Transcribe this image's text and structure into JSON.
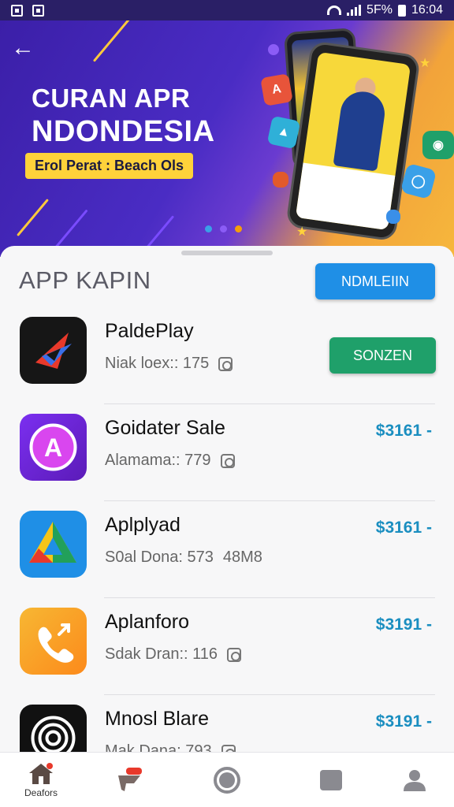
{
  "status_bar": {
    "network": "5F%",
    "time": "16:04"
  },
  "banner": {
    "title_line1": "CURAN APR",
    "title_line2": "NDONDESIA",
    "pill_text": "Erol Perat : Beach Ols"
  },
  "section": {
    "title": "APP KAPIN",
    "header_button": "NDMLEIIN"
  },
  "apps": [
    {
      "name": "PaldePlay",
      "meta": "Niak loex:: 175",
      "size": "",
      "action": "SONZEN",
      "price": ""
    },
    {
      "name": "Goidater Sale",
      "meta": "Alamama:: 779",
      "size": "",
      "action": "",
      "price": "$3161 -"
    },
    {
      "name": "Aplplyad",
      "meta": "S0al Dona: 573",
      "size": "48M8",
      "action": "",
      "price": "$3161 -"
    },
    {
      "name": "Aplanforo",
      "meta": "Sdak Dran:: 116",
      "size": "",
      "action": "",
      "price": "$3191 -"
    },
    {
      "name": "Mnosl Blare",
      "meta": "Mak Dana: 793",
      "size": "",
      "action": "",
      "price": "$3191 -"
    }
  ],
  "bottom_nav": {
    "home_label": "Deafors"
  },
  "colors": {
    "accent": "#1f8fe6",
    "get_button": "#1fa06a",
    "price": "#1a8ec0",
    "banner": "#3b1fa8"
  }
}
